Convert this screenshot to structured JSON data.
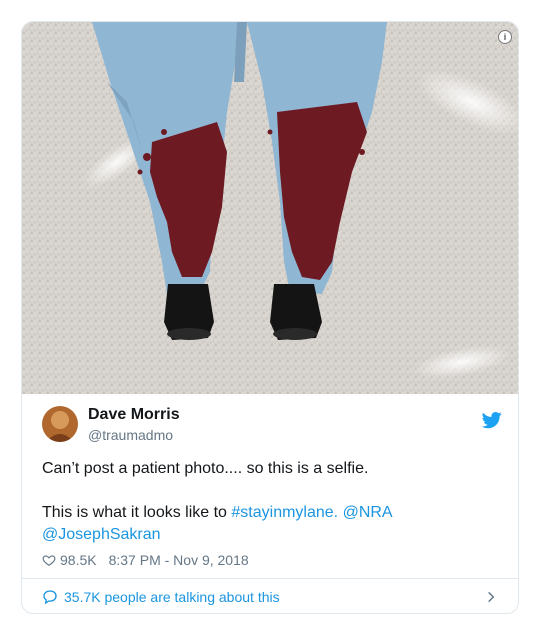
{
  "tweet": {
    "author_name": "Dave Morris",
    "author_handle": "@traumadmo",
    "line1": "Can’t post a patient photo.... so this is a selfie.",
    "line2_prefix": "This is what it looks like to ",
    "hashtag": "#stayinmylane.",
    "mention1": "@NRA",
    "mention2": "@JosephSakran",
    "likes": "98.5K",
    "timestamp": "8:37 PM - Nov 9, 2018",
    "conversation": "35.7K people are talking about this"
  },
  "media": {
    "info_icon": "info-icon",
    "alt_subject": "blood-stained-scrubs-photo"
  },
  "colors": {
    "link": "#1b95e0",
    "twitter_blue": "#1da1f2",
    "muted": "#657786",
    "border": "#e1e8ed",
    "blood": "#6e1a22",
    "scrubs": "#8fb6d3"
  },
  "icons": [
    "info-icon",
    "twitter-bird-icon",
    "heart-icon",
    "chat-bubble-icon",
    "chevron-right-icon"
  ]
}
